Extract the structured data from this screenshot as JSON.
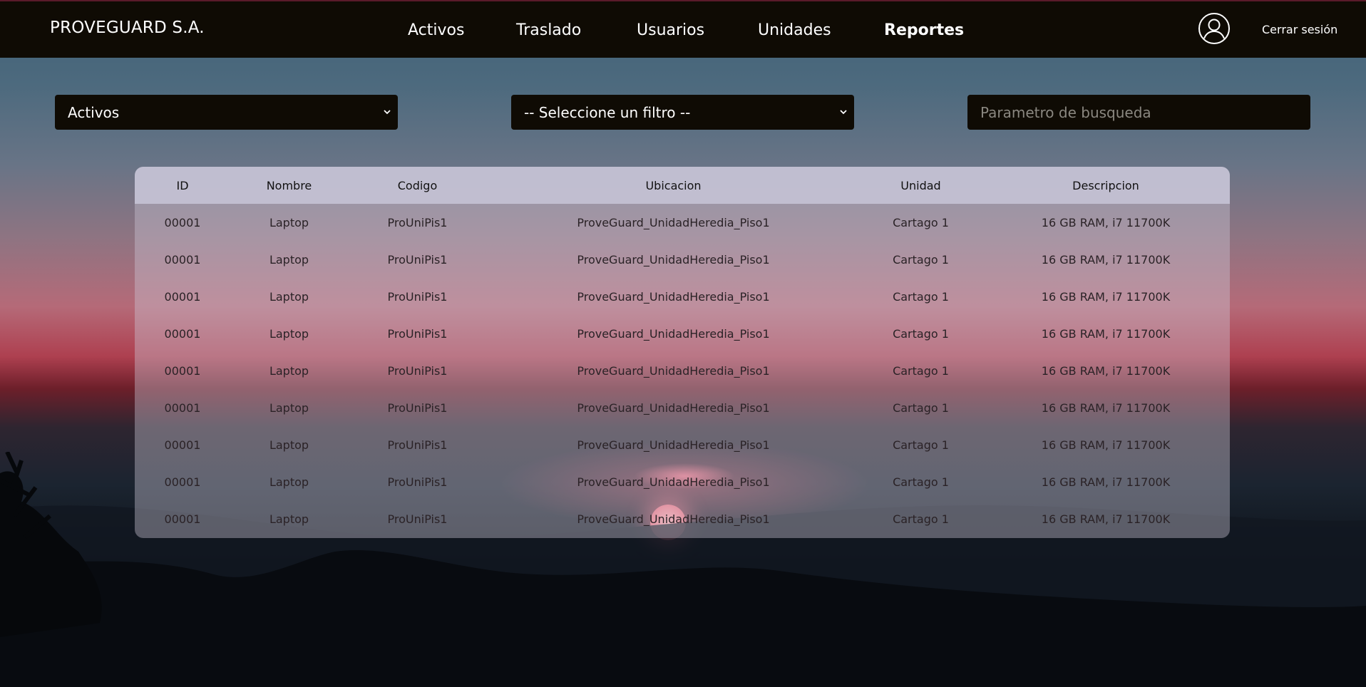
{
  "app": {
    "brand": "PROVEGUARD S.A.",
    "logout_label": "Cerrar sesión",
    "user_icon": "user-circle-icon"
  },
  "nav": {
    "items": [
      {
        "label": "Activos",
        "active": false
      },
      {
        "label": "Traslado",
        "active": false
      },
      {
        "label": "Usuarios",
        "active": false
      },
      {
        "label": "Unidades",
        "active": false
      },
      {
        "label": "Reportes",
        "active": true
      }
    ]
  },
  "filters": {
    "report_type": {
      "value": "Activos",
      "icon": "chevron-down-icon"
    },
    "filter": {
      "value": "-- Seleccione un filtro --",
      "icon": "chevron-down-icon"
    },
    "search": {
      "placeholder": "Parametro de busqueda",
      "value": ""
    }
  },
  "table": {
    "columns": [
      "ID",
      "Nombre",
      "Codigo",
      "Ubicacion",
      "Unidad",
      "Descripcion"
    ],
    "rows": [
      [
        "00001",
        "Laptop",
        "ProUniPis1",
        "ProveGuard_UnidadHeredia_Piso1",
        "Cartago 1",
        "16 GB RAM, i7 11700K"
      ],
      [
        "00001",
        "Laptop",
        "ProUniPis1",
        "ProveGuard_UnidadHeredia_Piso1",
        "Cartago 1",
        "16 GB RAM, i7 11700K"
      ],
      [
        "00001",
        "Laptop",
        "ProUniPis1",
        "ProveGuard_UnidadHeredia_Piso1",
        "Cartago 1",
        "16 GB RAM, i7 11700K"
      ],
      [
        "00001",
        "Laptop",
        "ProUniPis1",
        "ProveGuard_UnidadHeredia_Piso1",
        "Cartago 1",
        "16 GB RAM, i7 11700K"
      ],
      [
        "00001",
        "Laptop",
        "ProUniPis1",
        "ProveGuard_UnidadHeredia_Piso1",
        "Cartago 1",
        "16 GB RAM, i7 11700K"
      ],
      [
        "00001",
        "Laptop",
        "ProUniPis1",
        "ProveGuard_UnidadHeredia_Piso1",
        "Cartago 1",
        "16 GB RAM, i7 11700K"
      ],
      [
        "00001",
        "Laptop",
        "ProUniPis1",
        "ProveGuard_UnidadHeredia_Piso1",
        "Cartago 1",
        "16 GB RAM, i7 11700K"
      ],
      [
        "00001",
        "Laptop",
        "ProUniPis1",
        "ProveGuard_UnidadHeredia_Piso1",
        "Cartago 1",
        "16 GB RAM, i7 11700K"
      ],
      [
        "00001",
        "Laptop",
        "ProUniPis1",
        "ProveGuard_UnidadHeredia_Piso1",
        "Cartago 1",
        "16 GB RAM, i7 11700K"
      ]
    ]
  },
  "colors": {
    "topbar": "#0f0b04",
    "control_bg": "#0f0b04",
    "header_row": "#c6c4d6"
  }
}
